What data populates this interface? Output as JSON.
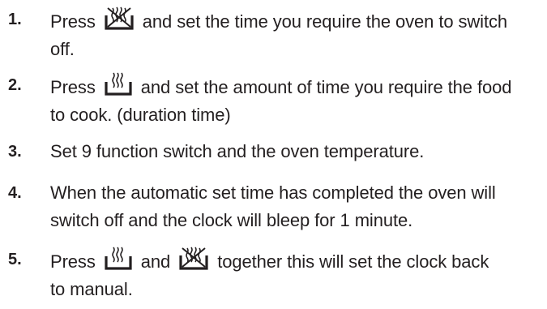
{
  "steps": [
    {
      "number": "1.",
      "before": "Press",
      "icon": "oven-off-icon",
      "after": "and set the time you require the oven to switch",
      "line2": "off."
    },
    {
      "number": "2.",
      "before": "Press",
      "icon": "cooking-duration-icon",
      "after": "and set the amount of time you require the food",
      "line2": "to cook. (duration time)"
    },
    {
      "number": "3.",
      "text": "Set 9 function switch and the oven temperature."
    },
    {
      "number": "4.",
      "line1": "When the automatic set time has completed the oven will",
      "line2": "switch off and the clock will bleep for 1 minute."
    },
    {
      "number": "5.",
      "before": "Press",
      "icon_a": "cooking-duration-icon",
      "middle": "and",
      "icon_b": "oven-off-icon",
      "after": "together this will set the clock back",
      "line2": "to manual."
    }
  ]
}
